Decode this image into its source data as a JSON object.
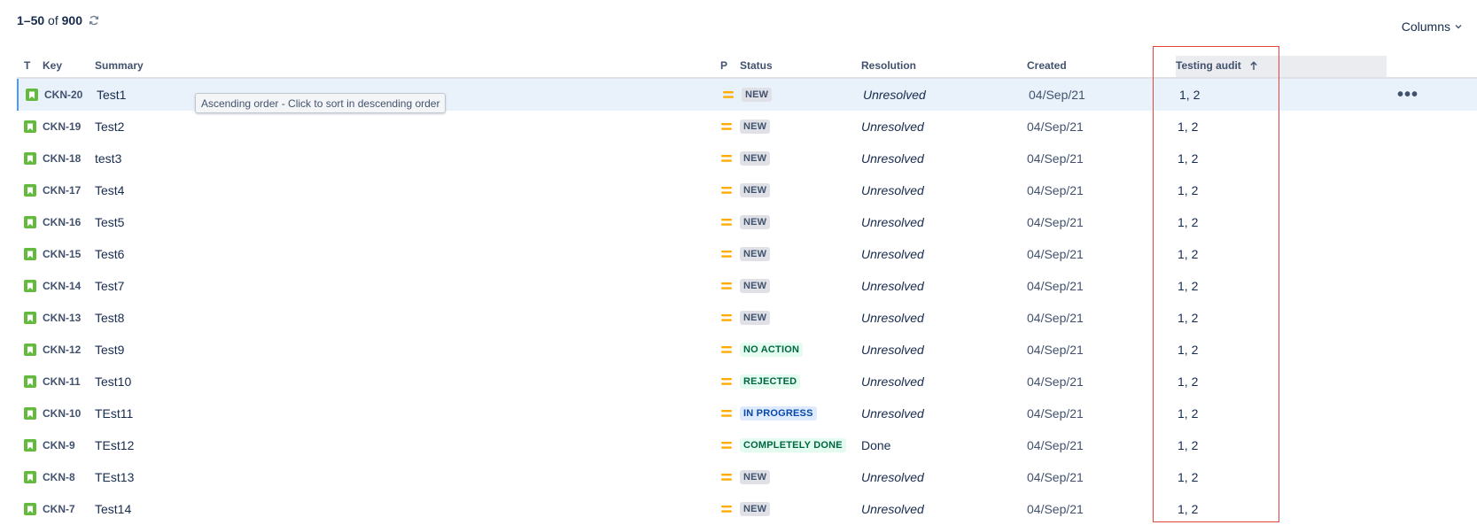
{
  "header": {
    "range": "1–50",
    "of_label": "of",
    "total": "900",
    "columns_label": "Columns"
  },
  "columns": {
    "type": "T",
    "key": "Key",
    "summary": "Summary",
    "priority": "P",
    "status": "Status",
    "resolution": "Resolution",
    "created": "Created",
    "testing_audit": "Testing audit"
  },
  "sort": {
    "column": "testing_audit",
    "direction": "ascending"
  },
  "tooltip": "Ascending order - Click to sort in descending order",
  "colors": {
    "accent_annotation": "#e8443a",
    "story_icon": "#63ba3c",
    "priority_medium": "#ffab00",
    "row_highlight": "#e9f2fa"
  },
  "rows": [
    {
      "key": "CKN-20",
      "summary": "Test1",
      "status": "NEW",
      "status_style": "grey",
      "resolution": "Unresolved",
      "created": "04/Sep/21",
      "testing_audit": "1, 2"
    },
    {
      "key": "CKN-19",
      "summary": "Test2",
      "status": "NEW",
      "status_style": "grey",
      "resolution": "Unresolved",
      "created": "04/Sep/21",
      "testing_audit": "1, 2"
    },
    {
      "key": "CKN-18",
      "summary": "test3",
      "status": "NEW",
      "status_style": "grey",
      "resolution": "Unresolved",
      "created": "04/Sep/21",
      "testing_audit": "1, 2"
    },
    {
      "key": "CKN-17",
      "summary": "Test4",
      "status": "NEW",
      "status_style": "grey",
      "resolution": "Unresolved",
      "created": "04/Sep/21",
      "testing_audit": "1, 2"
    },
    {
      "key": "CKN-16",
      "summary": "Test5",
      "status": "NEW",
      "status_style": "grey",
      "resolution": "Unresolved",
      "created": "04/Sep/21",
      "testing_audit": "1, 2"
    },
    {
      "key": "CKN-15",
      "summary": "Test6",
      "status": "NEW",
      "status_style": "grey",
      "resolution": "Unresolved",
      "created": "04/Sep/21",
      "testing_audit": "1, 2"
    },
    {
      "key": "CKN-14",
      "summary": "Test7",
      "status": "NEW",
      "status_style": "grey",
      "resolution": "Unresolved",
      "created": "04/Sep/21",
      "testing_audit": "1, 2"
    },
    {
      "key": "CKN-13",
      "summary": "Test8",
      "status": "NEW",
      "status_style": "grey",
      "resolution": "Unresolved",
      "created": "04/Sep/21",
      "testing_audit": "1, 2"
    },
    {
      "key": "CKN-12",
      "summary": "Test9",
      "status": "NO ACTION",
      "status_style": "green",
      "resolution": "Unresolved",
      "created": "04/Sep/21",
      "testing_audit": "1, 2"
    },
    {
      "key": "CKN-11",
      "summary": "Test10",
      "status": "REJECTED",
      "status_style": "green",
      "resolution": "Unresolved",
      "created": "04/Sep/21",
      "testing_audit": "1, 2"
    },
    {
      "key": "CKN-10",
      "summary": "TEst11",
      "status": "IN PROGRESS",
      "status_style": "blue",
      "resolution": "Unresolved",
      "created": "04/Sep/21",
      "testing_audit": "1, 2"
    },
    {
      "key": "CKN-9",
      "summary": "TEst12",
      "status": "COMPLETELY DONE",
      "status_style": "green",
      "resolution": "Done",
      "created": "04/Sep/21",
      "testing_audit": "1, 2"
    },
    {
      "key": "CKN-8",
      "summary": "TEst13",
      "status": "NEW",
      "status_style": "grey",
      "resolution": "Unresolved",
      "created": "04/Sep/21",
      "testing_audit": "1, 2"
    },
    {
      "key": "CKN-7",
      "summary": "Test14",
      "status": "NEW",
      "status_style": "grey",
      "resolution": "Unresolved",
      "created": "04/Sep/21",
      "testing_audit": "1, 2"
    }
  ]
}
